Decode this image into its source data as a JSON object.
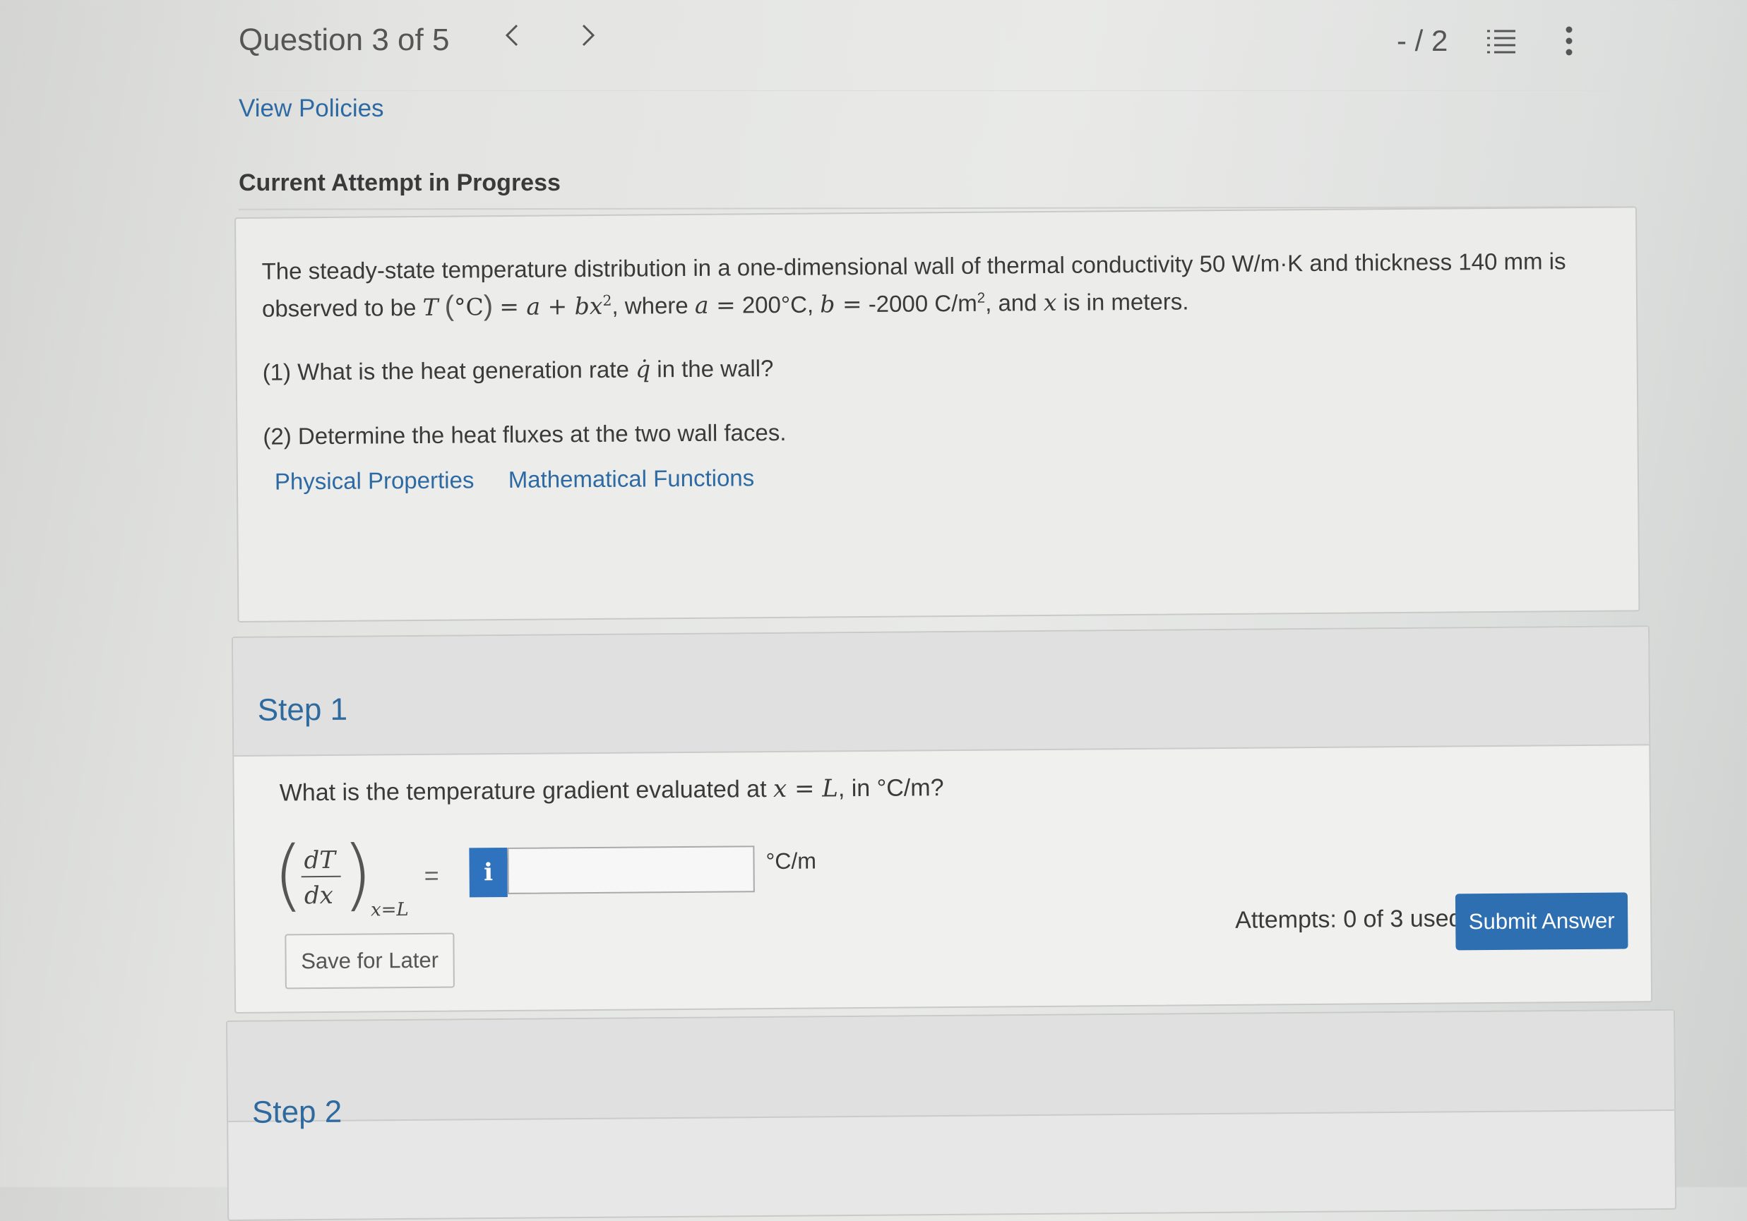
{
  "header": {
    "question_counter": "Question 3 of 5",
    "prev_icon": "chevron-left-icon",
    "next_icon": "chevron-right-icon",
    "score": "- / 2",
    "list_icon": "list-icon",
    "more_icon": "vertical-ellipsis-icon"
  },
  "links": {
    "view_policies": "View Policies"
  },
  "attempt_heading": "Current Attempt in Progress",
  "question": {
    "line1": "The steady-state temperature distribution in a one-dimensional wall of thermal conductivity 50 W/m·K and thickness 140 mm is",
    "line2_prefix": "observed to be",
    "T": "T",
    "degC": "°C",
    "eq_rhs": "= a + bx",
    "where": ", where",
    "a_eq": "a =",
    "a_val": "200°C,",
    "b_eq": "b =",
    "b_val": "-2000 C/m",
    "line2_suffix": ", and",
    "x": "x",
    "is_in_meters": "is in meters.",
    "part1_prefix": "(1) What is the heat generation rate",
    "qdot": "q̇",
    "part1_suffix": "in the wall?",
    "part2": "(2) Determine the heat fluxes at the two wall faces.",
    "resource_links": [
      "Physical Properties",
      "Mathematical Functions"
    ]
  },
  "step1": {
    "title": "Step 1",
    "prompt_prefix": "What is the temperature gradient evaluated at",
    "prompt_math": "x = L",
    "prompt_suffix": ", in °C/m?",
    "frac_num": "dT",
    "frac_den": "dx",
    "subscript": "x=L",
    "equals": "=",
    "info_label": "i",
    "answer_value": "",
    "unit": "°C/m",
    "attempts": "Attempts: 0 of 3 used",
    "save_label": "Save for Later",
    "submit_label": "Submit Answer"
  },
  "step2": {
    "title": "Step 2"
  },
  "colors": {
    "link": "#2d6aa3",
    "primary_button": "#2e6fb1",
    "step_title": "#2f6a9e"
  }
}
